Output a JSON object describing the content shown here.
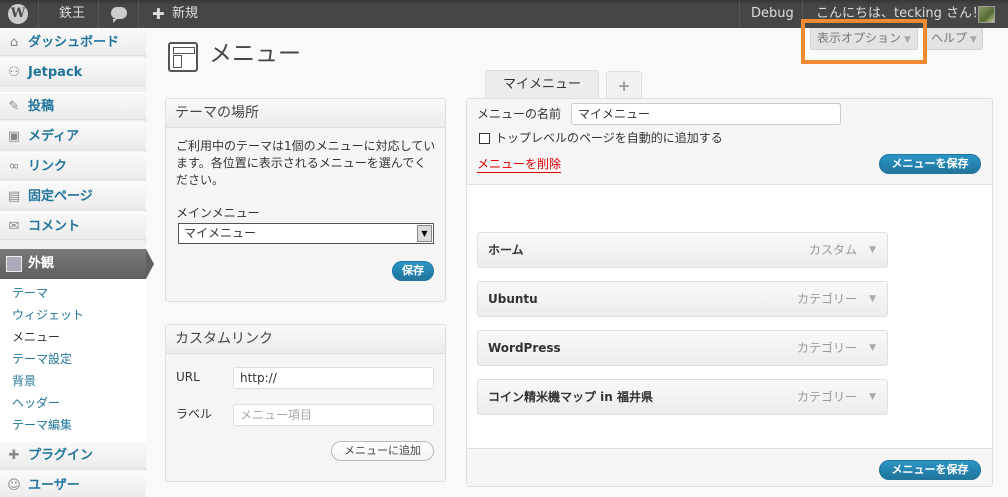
{
  "adminbar": {
    "wp_logo": "W",
    "site_name": "鉄王",
    "comments_icon": "speech-bubble-icon",
    "new_label": "新規",
    "debug_label": "Debug",
    "greeting": "こんにちは、tecking さん！"
  },
  "screen_tabs": {
    "screen_options": "表示オプション",
    "help": "ヘルプ"
  },
  "sidebar": {
    "items": [
      {
        "label": "ダッシュボード",
        "icon": "⌂"
      },
      {
        "label": "Jetpack",
        "icon": "⚇"
      },
      {
        "label": "投稿",
        "icon": "✎"
      },
      {
        "label": "メディア",
        "icon": "▣"
      },
      {
        "label": "リンク",
        "icon": "∞"
      },
      {
        "label": "固定ページ",
        "icon": "▤"
      },
      {
        "label": "コメント",
        "icon": "✉"
      },
      {
        "label": "外観",
        "icon": ""
      },
      {
        "label": "プラグイン",
        "icon": "✚"
      },
      {
        "label": "ユーザー",
        "icon": "☺"
      }
    ],
    "submenu": [
      "テーマ",
      "ウィジェット",
      "メニュー",
      "テーマ設定",
      "背景",
      "ヘッダー",
      "テーマ編集"
    ]
  },
  "page": {
    "title": "メニュー"
  },
  "theme_location": {
    "title": "テーマの場所",
    "description_line1": "ご利用中のテーマは1個のメニューに対応してい",
    "description_line2": "ます。各位置に表示されるメニューを選んでく",
    "description_line3": "ださい。",
    "main_menu_label": "メインメニュー",
    "selected_menu": "マイメニュー",
    "save_label": "保存"
  },
  "custom_link": {
    "title": "カスタムリンク",
    "url_label": "URL",
    "url_value": "http://",
    "label_label": "ラベル",
    "label_placeholder": "メニュー項目",
    "add_button": "メニューに追加"
  },
  "menu_tabs": {
    "active_tab": "マイメニュー",
    "add_tab": "+"
  },
  "menu_editor": {
    "name_label": "メニューの名前",
    "name_value": "マイメニュー",
    "auto_add_label": "トップレベルのページを自動的に追加する",
    "delete_link": "メニューを削除",
    "save_button": "メニューを保存",
    "items": [
      {
        "title": "ホーム",
        "type": "カスタム"
      },
      {
        "title": "Ubuntu",
        "type": "カテゴリー"
      },
      {
        "title": "WordPress",
        "type": "カテゴリー"
      },
      {
        "title": "コイン精米機マップ in 福井県",
        "type": "カテゴリー"
      }
    ]
  },
  "colors": {
    "link": "#21759b",
    "highlight": "#ef8a33",
    "delete": "#dd0000",
    "adminbar": "#464646"
  }
}
